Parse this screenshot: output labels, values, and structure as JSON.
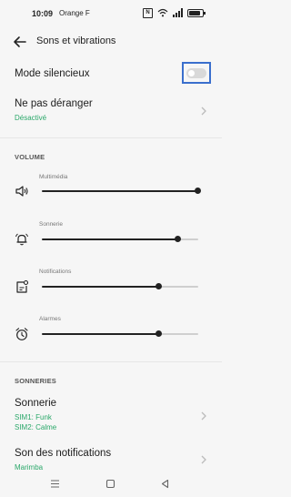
{
  "status_bar": {
    "time": "10:09",
    "carrier": "Orange F"
  },
  "header": {
    "title": "Sons et vibrations"
  },
  "silent_mode": {
    "label": "Mode silencieux",
    "enabled": false
  },
  "do_not_disturb": {
    "label": "Ne pas déranger",
    "status": "Désactivé"
  },
  "volume": {
    "section_label": "VOLUME",
    "sliders": [
      {
        "label": "Multimédia",
        "icon": "speaker-icon",
        "level": 1.0
      },
      {
        "label": "Sonnerie",
        "icon": "bell-icon",
        "level": 0.87
      },
      {
        "label": "Notifications",
        "icon": "notification-icon",
        "level": 0.75
      },
      {
        "label": "Alarmes",
        "icon": "alarm-clock-icon",
        "level": 0.75
      }
    ]
  },
  "ringtones": {
    "section_label": "SONNERIES",
    "ringtone": {
      "label": "Sonnerie",
      "sim1": "SIM1: Funk",
      "sim2": "SIM2: Calme"
    },
    "notification_sound": {
      "label": "Son des notifications",
      "value": "Marimba"
    }
  },
  "colors": {
    "accent_green": "#2ba86a",
    "highlight_blue": "#3a6fcd",
    "background": "#f6f6f6"
  }
}
